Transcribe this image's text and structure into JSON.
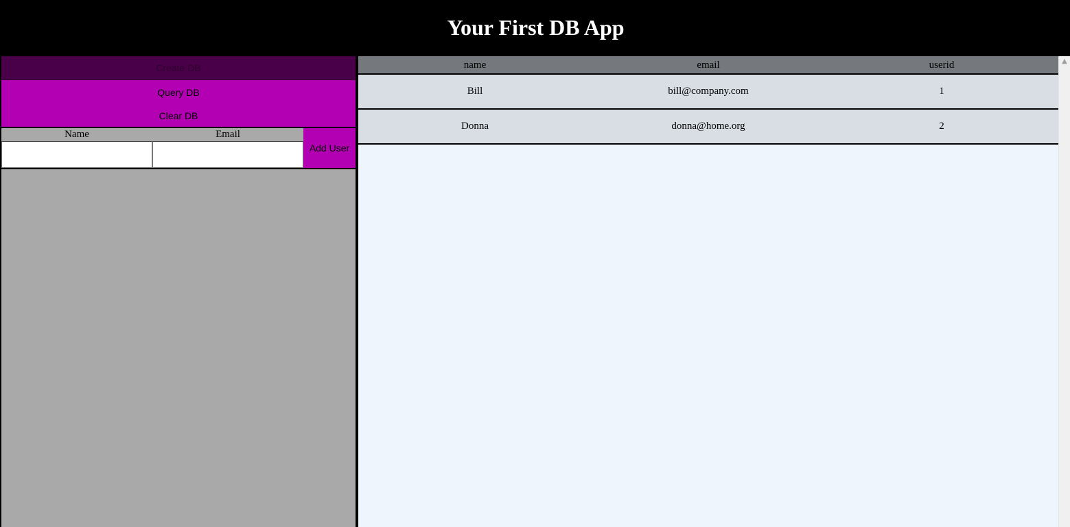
{
  "header": {
    "title": "Your First DB App"
  },
  "controls": {
    "create_label": "Create DB",
    "query_label": "Query DB",
    "clear_label": "Clear DB"
  },
  "form": {
    "name_label": "Name",
    "email_label": "Email",
    "name_value": "",
    "email_value": "",
    "add_label": "Add User"
  },
  "table": {
    "columns": [
      "name",
      "email",
      "userid"
    ],
    "rows": [
      {
        "name": "Bill",
        "email": "bill@company.com",
        "userid": "1"
      },
      {
        "name": "Donna",
        "email": "donna@home.org",
        "userid": "2"
      }
    ]
  },
  "colors": {
    "button": "#b300b3",
    "button_disabled": "#4a0049",
    "table_header": "#75787c",
    "row": "#d8dee4",
    "panel": "#a9a9a9",
    "content_bg": "#eef5fc"
  },
  "icons": {
    "scroll_up": "chevron-up-icon"
  }
}
